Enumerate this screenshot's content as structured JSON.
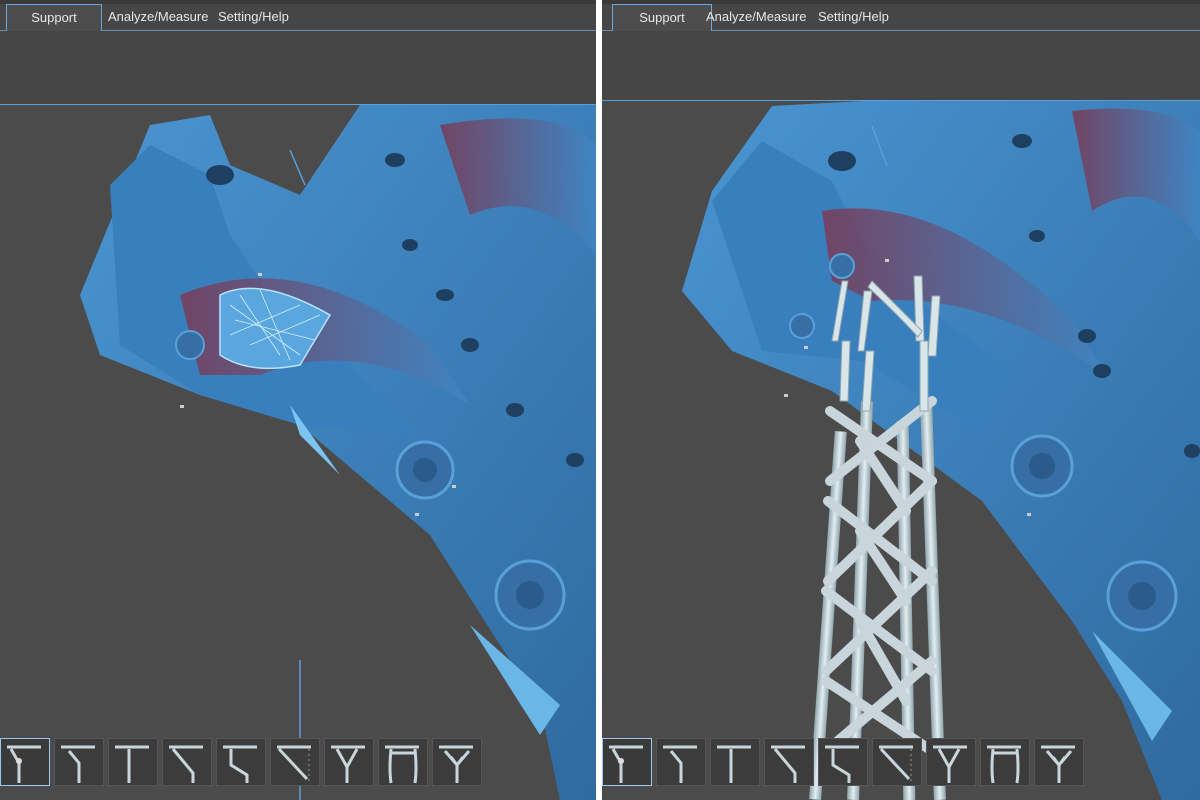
{
  "left_panel": {
    "tabs": [
      {
        "label": "Support",
        "active": true
      },
      {
        "label": "Analyze/Measure",
        "active": false
      },
      {
        "label": "Setting/Help",
        "active": false
      }
    ],
    "tools": [
      {
        "icon": "support-tool-1-icon"
      },
      {
        "icon": "support-tool-2-icon"
      },
      {
        "icon": "support-tool-3-icon"
      },
      {
        "icon": "support-tool-4-icon"
      },
      {
        "icon": "support-tool-5-icon"
      },
      {
        "icon": "support-tool-6-icon"
      },
      {
        "icon": "support-tool-7-icon"
      },
      {
        "icon": "support-tool-8-icon"
      },
      {
        "icon": "support-tool-9-icon"
      }
    ]
  },
  "right_panel": {
    "tabs": [
      {
        "label": "Support",
        "active": true
      },
      {
        "label": "Analyze/Measure",
        "active": false
      },
      {
        "label": "Setting/Help",
        "active": false
      }
    ],
    "tools": [
      {
        "icon": "support-tool-1-icon"
      },
      {
        "icon": "support-tool-2-icon"
      },
      {
        "icon": "support-tool-3-icon"
      },
      {
        "icon": "support-tool-4-icon"
      },
      {
        "icon": "support-tool-5-icon"
      },
      {
        "icon": "support-tool-6-icon"
      },
      {
        "icon": "support-tool-7-icon"
      },
      {
        "icon": "support-tool-8-icon"
      },
      {
        "icon": "support-tool-9-icon"
      }
    ]
  },
  "colors": {
    "model_blue": "#3f86c4",
    "model_shadow": "#2f6aa0",
    "model_red": "#7a3a55",
    "support_gray": "#c8d6dc",
    "viewport_bg": "#4b4b4b",
    "accent": "#6aa7d8"
  }
}
